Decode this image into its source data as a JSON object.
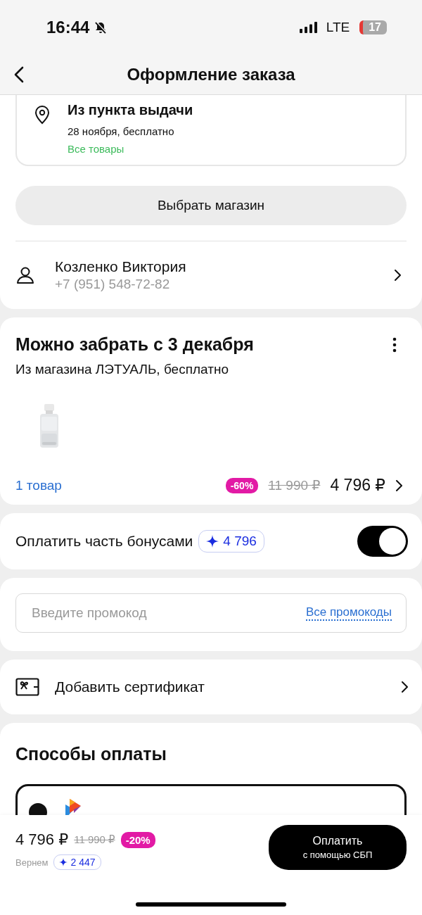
{
  "status_bar": {
    "time": "16:44",
    "network": "LTE",
    "battery": "17"
  },
  "header": {
    "title": "Оформление заказа"
  },
  "delivery_option": {
    "title": "Из пункта выдачи",
    "date": "28 ноября, бесплатно",
    "note": "Все товары"
  },
  "choose_store_button": "Выбрать магазин",
  "recipient": {
    "name": "Козленко Виктория",
    "phone": "+7 (951) 548-72-82"
  },
  "shipment": {
    "title": "Можно забрать с 3 декабря",
    "subtitle": "Из магазина ЛЭТУАЛЬ, бесплатно",
    "count": "1 товар",
    "discount": "-60%",
    "old_price": "11 990 ₽",
    "price": "4 796 ₽"
  },
  "bonus": {
    "label": "Оплатить часть бонусами",
    "amount": "4 796",
    "on": true
  },
  "promo": {
    "placeholder": "Введите промокод",
    "link": "Все промокоды"
  },
  "certificate": {
    "label": "Добавить сертификат"
  },
  "payment": {
    "title": "Способы оплаты",
    "options": [
      {
        "selected": true
      }
    ]
  },
  "footer": {
    "price": "4 796 ₽",
    "old_price": "11 990 ₽",
    "discount": "-20%",
    "cashback_label": "Вернем",
    "cashback": "2 447",
    "pay_button": {
      "label": "Оплатить",
      "sublabel": "с помощью СБП"
    }
  }
}
